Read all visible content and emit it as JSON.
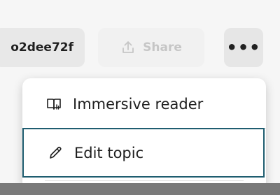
{
  "toolbar": {
    "id_chip": "o2dee72f",
    "share_label": "Share",
    "share_icon": "share-upload-icon",
    "more_label": "•••",
    "more_icon": "more-horizontal-icon"
  },
  "menu": {
    "items": [
      {
        "label": "Immersive reader",
        "icon": "immersive-reader-icon"
      },
      {
        "label": "Edit topic",
        "icon": "pencil-icon",
        "focused": true
      }
    ]
  },
  "colors": {
    "focus_border": "#1f5d70",
    "background": "#f6f6f6",
    "menu_background": "#ffffff",
    "disabled_text": "#c6c6c6"
  }
}
